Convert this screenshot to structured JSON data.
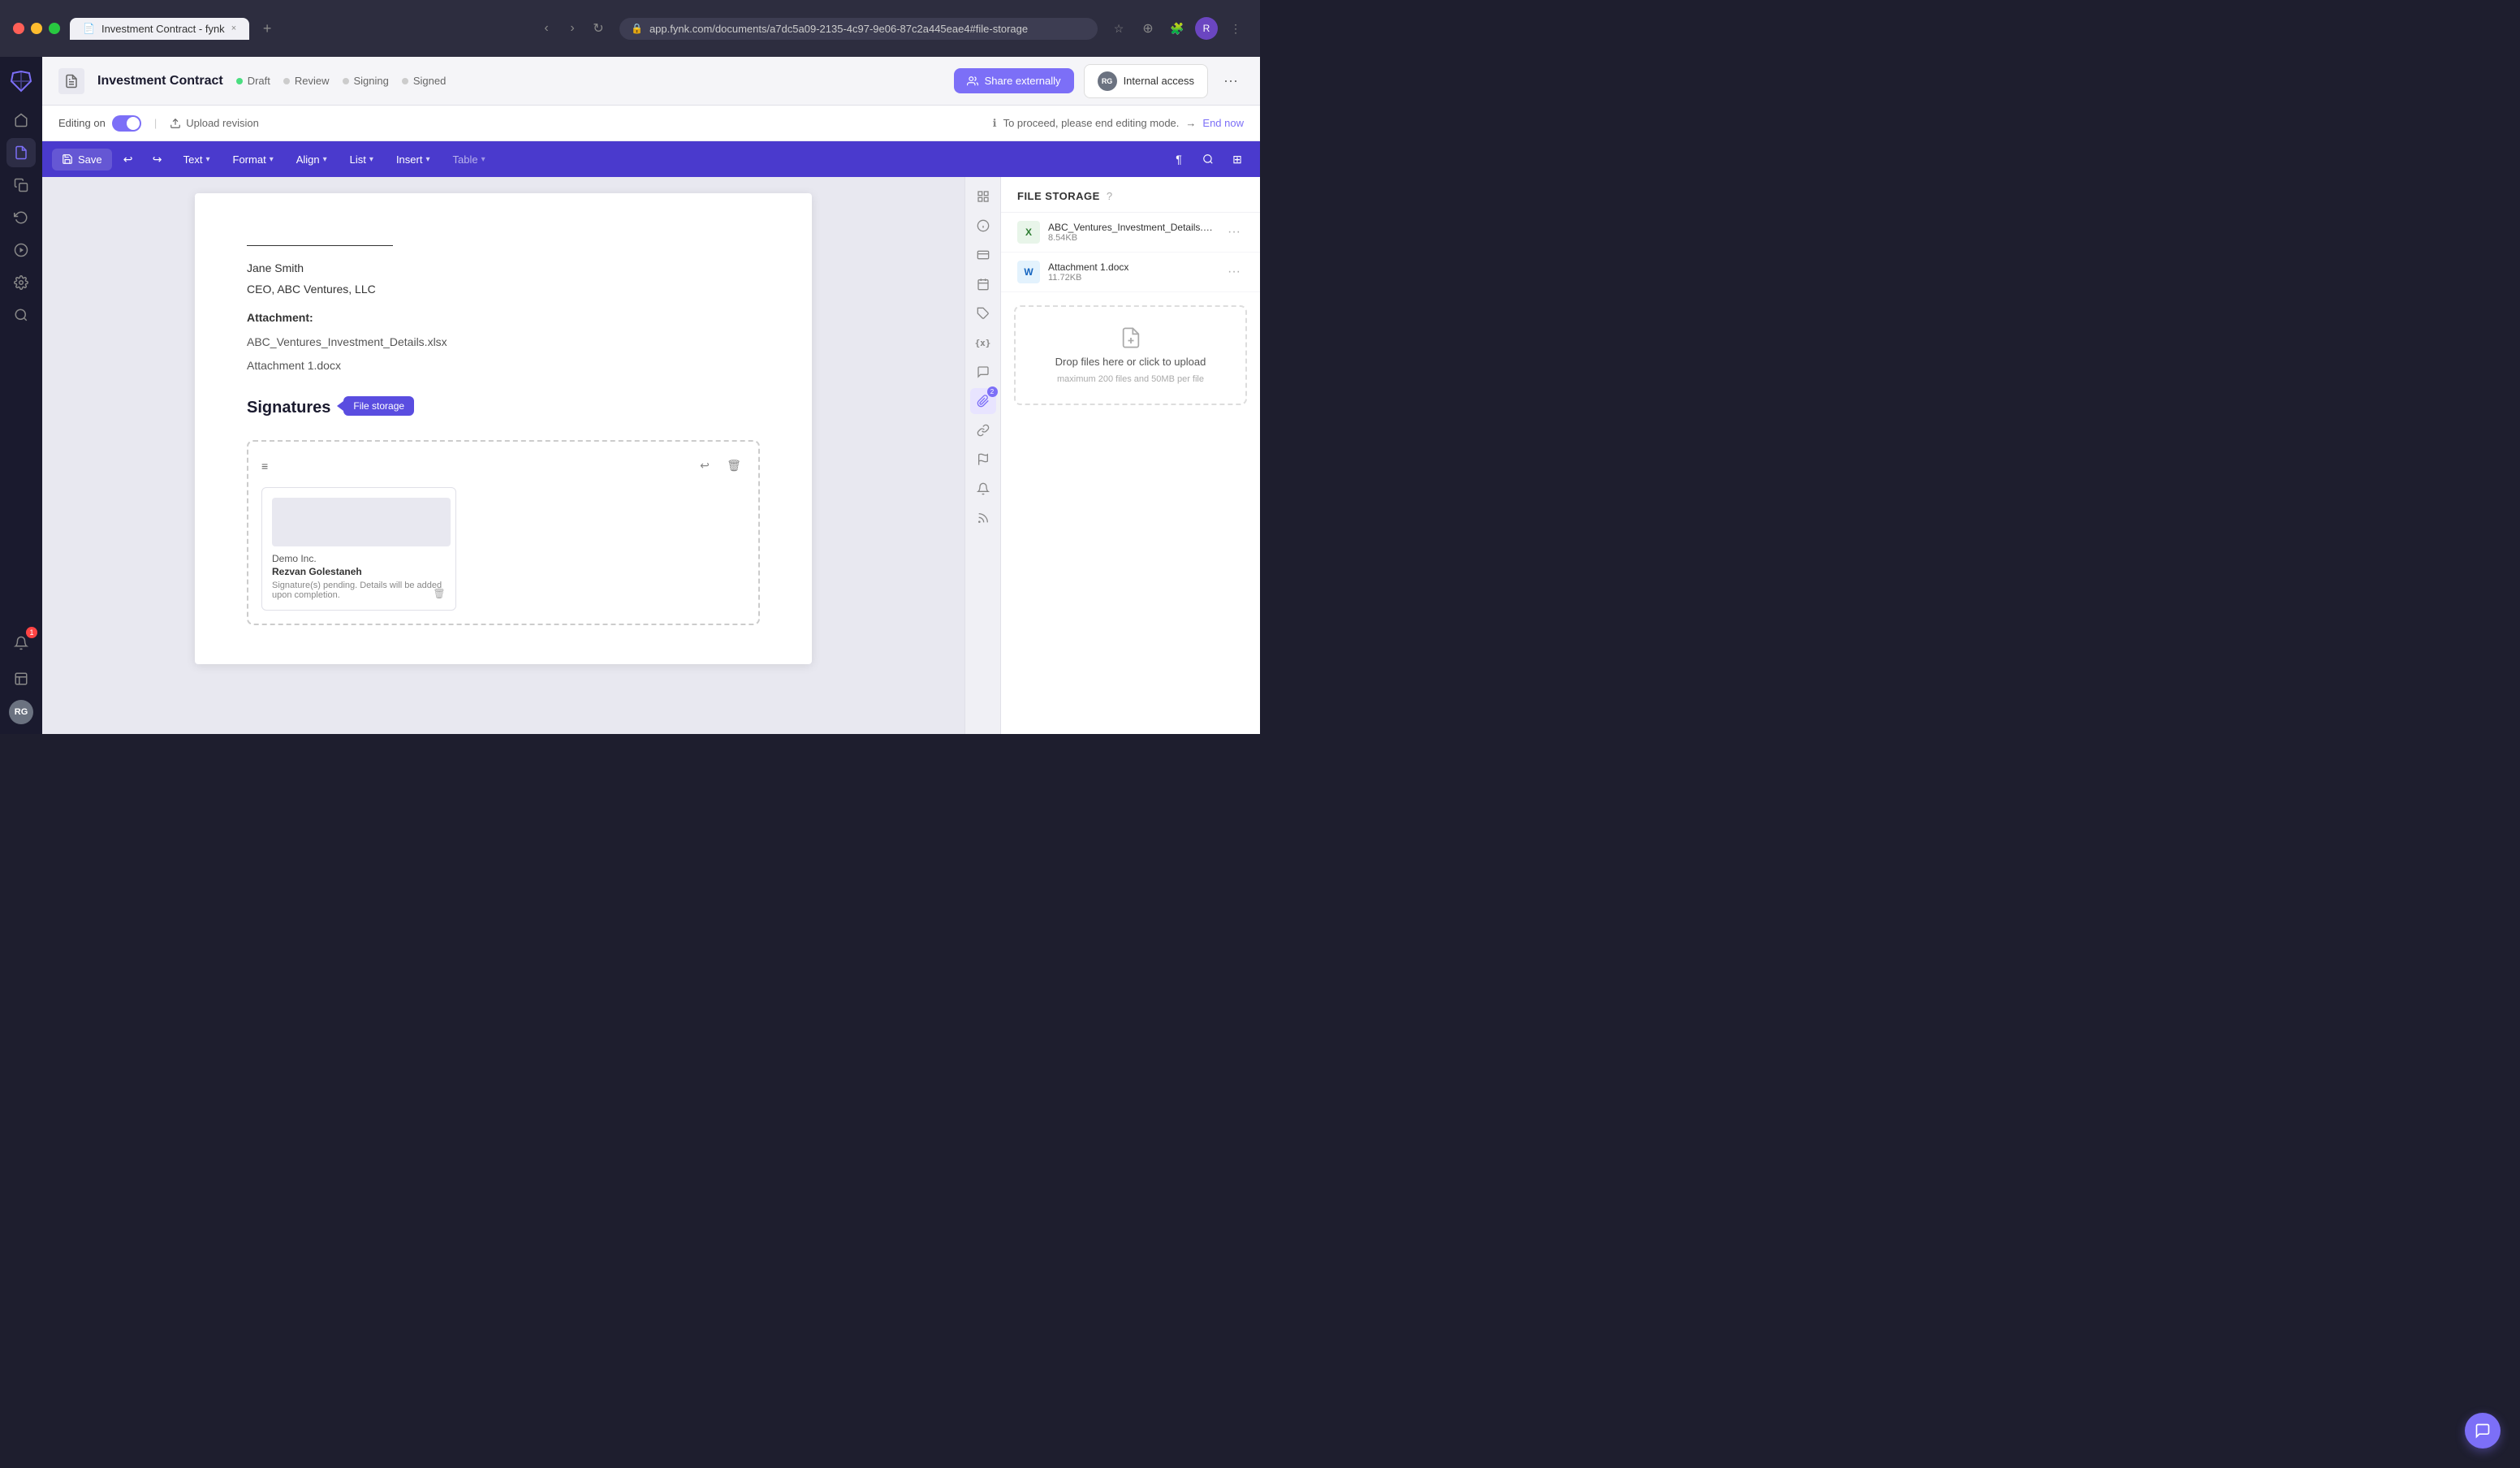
{
  "browser": {
    "tab_title": "Investment Contract - fynk",
    "url": "app.fynk.com/documents/a7dc5a09-2135-4c97-9e06-87c2a445eae4#file-storage",
    "close_label": "×",
    "add_tab_label": "+"
  },
  "header": {
    "doc_title": "Investment Contract",
    "statuses": [
      {
        "label": "Draft",
        "active": true
      },
      {
        "label": "Review",
        "active": false
      },
      {
        "label": "Signing",
        "active": false
      },
      {
        "label": "Signed",
        "active": false
      }
    ],
    "share_btn": "Share externally",
    "internal_btn": "Internal access",
    "avatar_initials": "RG"
  },
  "editing_bar": {
    "editing_on_label": "Editing on",
    "upload_revision_label": "Upload revision",
    "proceed_label": "To proceed, please end editing mode.",
    "arrow_label": "→ End now"
  },
  "toolbar": {
    "save_label": "Save",
    "text_label": "Text",
    "format_label": "Format",
    "align_label": "Align",
    "list_label": "List",
    "insert_label": "Insert",
    "table_label": "Table"
  },
  "document": {
    "underline": "",
    "name": "Jane Smith",
    "role": "CEO, ABC Ventures, LLC",
    "attachment_label": "Attachment:",
    "attachments": [
      "ABC_Ventures_Investment_Details.xlsx",
      "Attachment 1.docx"
    ],
    "signatures_title": "Signatures",
    "signature": {
      "company": "Demo Inc.",
      "person": "Rezvan Golestaneh",
      "pending_text": "Signature(s) pending. Details will be added upon completion."
    }
  },
  "file_storage": {
    "title": "FILE STORAGE",
    "files": [
      {
        "name": "ABC_Ventures_Investment_Details.xlsx",
        "size": "8.54KB",
        "type": "xlsx"
      },
      {
        "name": "Attachment 1.docx",
        "size": "11.72KB",
        "type": "docx"
      }
    ],
    "upload_zone_text": "Drop files here or click to upload",
    "upload_zone_sub": "maximum 200 files and 50MB per file",
    "tooltip": "File storage"
  },
  "sidebar": {
    "icons": [
      {
        "name": "home-icon",
        "symbol": "⌂",
        "active": false
      },
      {
        "name": "document-icon",
        "symbol": "📄",
        "active": true
      },
      {
        "name": "copy-icon",
        "symbol": "⎘",
        "active": false
      },
      {
        "name": "refresh-icon",
        "symbol": "↻",
        "active": false
      },
      {
        "name": "play-icon",
        "symbol": "▶",
        "active": false
      },
      {
        "name": "settings-icon",
        "symbol": "⚙",
        "active": false
      },
      {
        "name": "search-icon",
        "symbol": "🔍",
        "active": false
      }
    ],
    "bottom_icons": [
      {
        "name": "bell-icon",
        "symbol": "🔔",
        "badge": "1"
      },
      {
        "name": "analytics-icon",
        "symbol": "📊"
      }
    ],
    "avatar_initials": "RG"
  },
  "right_panel_icons": [
    {
      "name": "grid-icon",
      "symbol": "⊞",
      "active": false
    },
    {
      "name": "info-icon",
      "symbol": "ℹ",
      "active": false
    },
    {
      "name": "card-icon",
      "symbol": "⊟",
      "active": false
    },
    {
      "name": "calendar-icon",
      "symbol": "📅",
      "active": false
    },
    {
      "name": "tag-icon",
      "symbol": "🏷",
      "active": false
    },
    {
      "name": "variable-icon",
      "symbol": "{x}",
      "active": false
    },
    {
      "name": "comment-icon",
      "symbol": "💬",
      "active": false
    },
    {
      "name": "attachment-icon",
      "symbol": "📎",
      "active": true,
      "badge": "2"
    },
    {
      "name": "link-icon",
      "symbol": "🔗",
      "active": false
    },
    {
      "name": "flag-icon",
      "symbol": "⚑",
      "active": false
    },
    {
      "name": "bell2-icon",
      "symbol": "🔔",
      "active": false
    },
    {
      "name": "feed-icon",
      "symbol": "☰",
      "active": false
    }
  ]
}
